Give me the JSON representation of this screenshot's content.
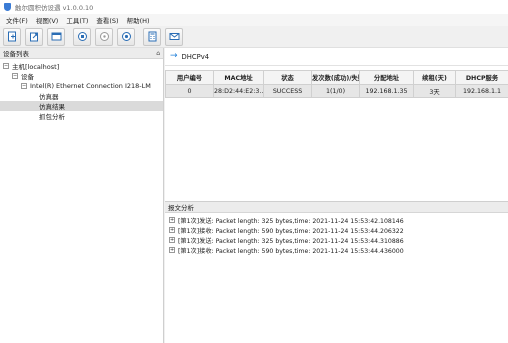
{
  "app": {
    "title": "触尔圆积仿设遇 v1.0.0.10"
  },
  "menu": [
    "文件(F)",
    "视图(V)",
    "工具(T)",
    "查看(S)",
    "帮助(H)"
  ],
  "toolbar": [
    {
      "name": "new-doc-icon"
    },
    {
      "name": "open-doc-icon"
    },
    {
      "name": "window-icon"
    },
    {
      "name": "stop-circle-icon"
    },
    {
      "name": "pause-circle-icon"
    },
    {
      "name": "play-circle-icon"
    },
    {
      "name": "calculator-icon"
    },
    {
      "name": "mail-icon"
    }
  ],
  "device_panel": {
    "header": "设备列表",
    "pin": "⌂",
    "tree": {
      "host": "主机[localhost]",
      "device": "设备",
      "adapter": "Intel(R) Ethernet Connection I218-LM",
      "children": [
        "仿真器",
        "仿真结果",
        "抓包分析"
      ]
    }
  },
  "dhcp": {
    "title": "DHCPv4"
  },
  "results_table": {
    "columns": [
      "用户编号",
      "MAC地址",
      "状态",
      "发次数(成功)/失败",
      "分配地址",
      "续租(天)",
      "DHCP服务"
    ],
    "rows": [
      [
        "0",
        "28:D2:44:E2:3...",
        "SUCCESS",
        "1(1/0)",
        "192.168.1.35",
        "3天",
        "192.168.1.1"
      ]
    ]
  },
  "analysis": {
    "header": "报文分析",
    "entries": [
      "[第1次]发送: Packet length: 325 bytes,time: 2021-11-24 15:53:42.108146",
      "[第1次]接收: Packet length: 590 bytes,time: 2021-11-24 15:53:44.206322",
      "[第1次]发送: Packet length: 325 bytes,time: 2021-11-24 15:53:44.310886",
      "[第1次]接收: Packet length: 590 bytes,time: 2021-11-24 15:53:44.436000"
    ]
  },
  "colors": {
    "accent": "#1f7fd8",
    "selected_row": "#e6e6e6"
  }
}
